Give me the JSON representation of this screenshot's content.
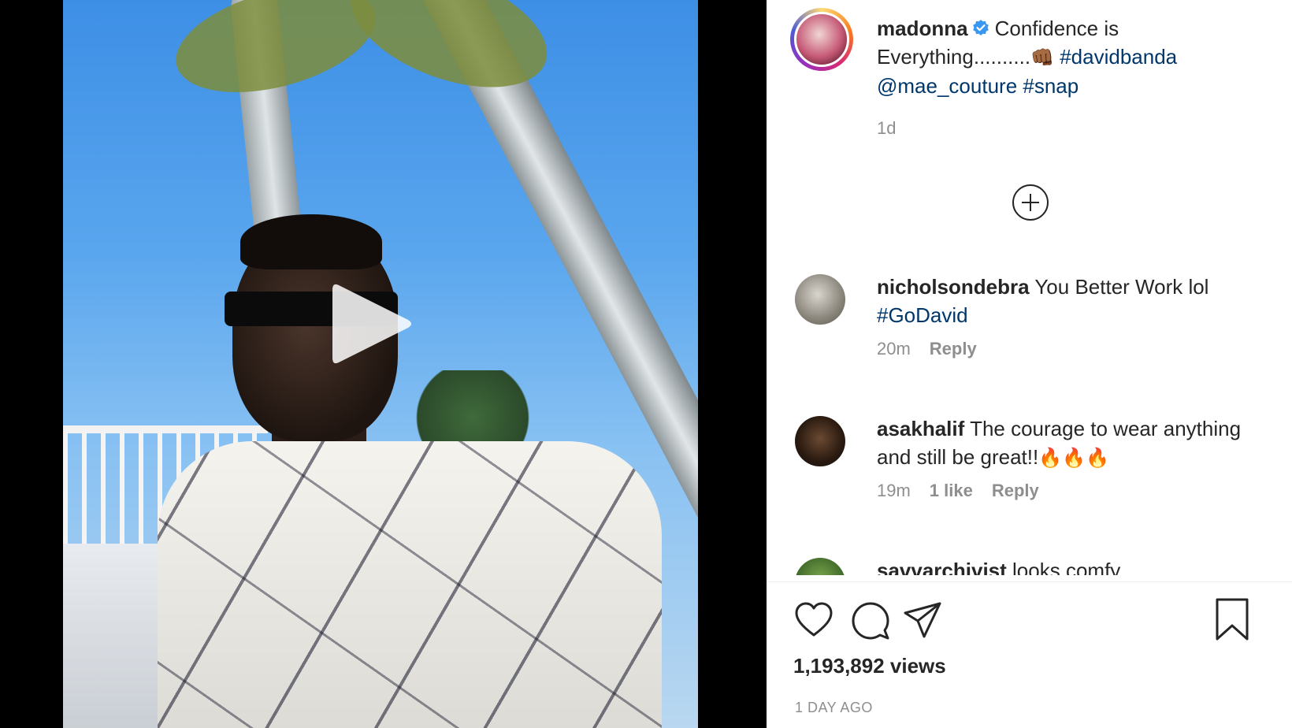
{
  "post": {
    "author": {
      "username": "madonna",
      "verified": true
    },
    "caption": {
      "text_before": "Confidence is Everything..........",
      "emoji": "👊🏾",
      "hashtag_1": "#davidbanda",
      "mention": "@mae_couture",
      "hashtag_2": "#snap",
      "time": "1d"
    },
    "comments": [
      {
        "username": "nicholsondebra",
        "text": "You Better Work lol",
        "hashtag": "#GoDavid",
        "time": "20m",
        "reply_label": "Reply"
      },
      {
        "username": "asakhalif",
        "text": "The courage to wear anything and still be great!!",
        "emoji": "🔥🔥🔥",
        "time": "19m",
        "likes": "1 like",
        "reply_label": "Reply"
      },
      {
        "username": "savvarchivist",
        "text": "looks comfy"
      }
    ],
    "views": "1,193,892 views",
    "date": "1 DAY AGO"
  },
  "icons": {
    "play": "play-icon",
    "load_more": "plus-circle-icon",
    "like": "heart-icon",
    "comment": "comment-bubble-icon",
    "share": "paper-plane-icon",
    "save": "bookmark-icon",
    "verified": "verified-badge-icon"
  },
  "colors": {
    "link": "#00376b",
    "text": "#262626",
    "muted": "#8e8e8e",
    "verified_blue": "#3897f0"
  }
}
